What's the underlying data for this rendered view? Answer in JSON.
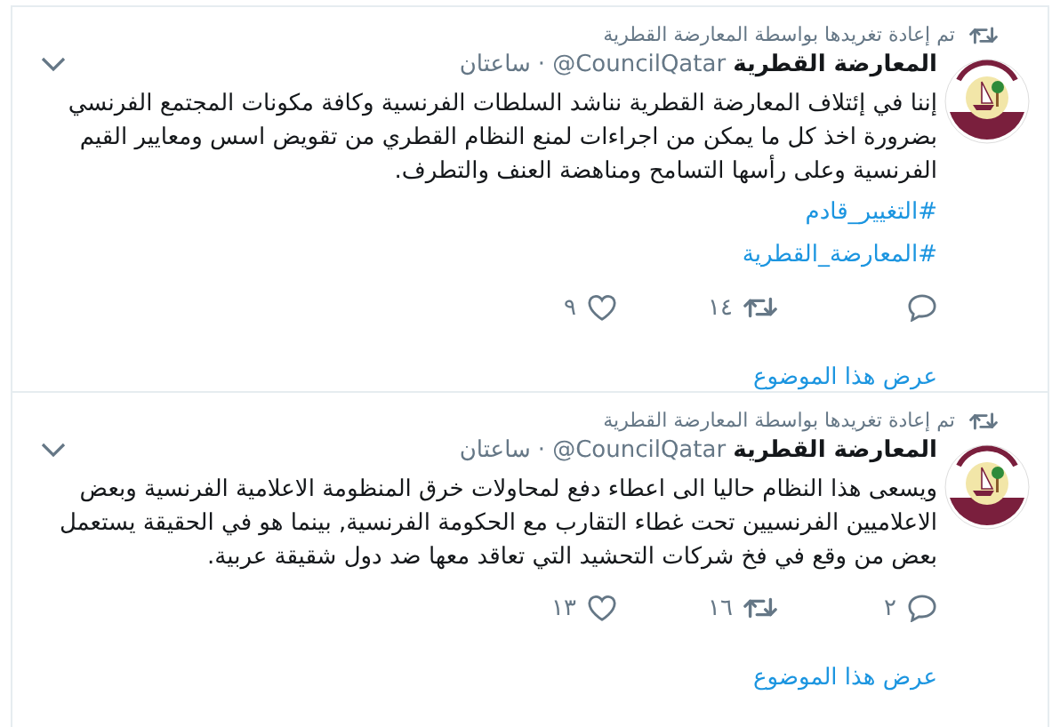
{
  "tweets": [
    {
      "retweet_note": "تم إعادة تغريدها بواسطة المعارضة القطرية",
      "name": "المعارضة القطرية",
      "handle": "@CouncilQatar",
      "separator": "·",
      "time": "ساعتان",
      "text": "إننا في إئتلاف المعارضة القطرية نناشد السلطات الفرنسية وكافة مكونات المجتمع الفرنسي بضرورة اخذ كل ما يمكن من اجراءات لمنع النظام القطري من تقويض اسس ومعايير القيم الفرنسية وعلى رأسها التسامح ومناهضة العنف والتطرف.",
      "hashtags": [
        "#التغيير_قادم",
        "#المعارضة_القطرية"
      ],
      "retweets": "١٤",
      "likes": "٩",
      "show_thread": "عرض هذا الموضوع"
    },
    {
      "retweet_note": "تم إعادة تغريدها بواسطة المعارضة القطرية",
      "name": "المعارضة القطرية",
      "handle": "@CouncilQatar",
      "separator": "·",
      "time": "ساعتان",
      "text": "ويسعى هذا النظام حاليا الى اعطاء دفع لمحاولات خرق المنظومة الاعلامية الفرنسية وبعض الاعلاميين الفرنسيين تحت غطاء التقارب مع الحكومة الفرنسية, بينما هو في الحقيقة يستعمل بعض من وقع في فخ شركات التحشيد التي تعاقد معها ضد دول شقيقة عربية.",
      "replies": "٢",
      "retweets": "١٦",
      "likes": "١٣",
      "show_thread": "عرض هذا الموضوع"
    }
  ]
}
